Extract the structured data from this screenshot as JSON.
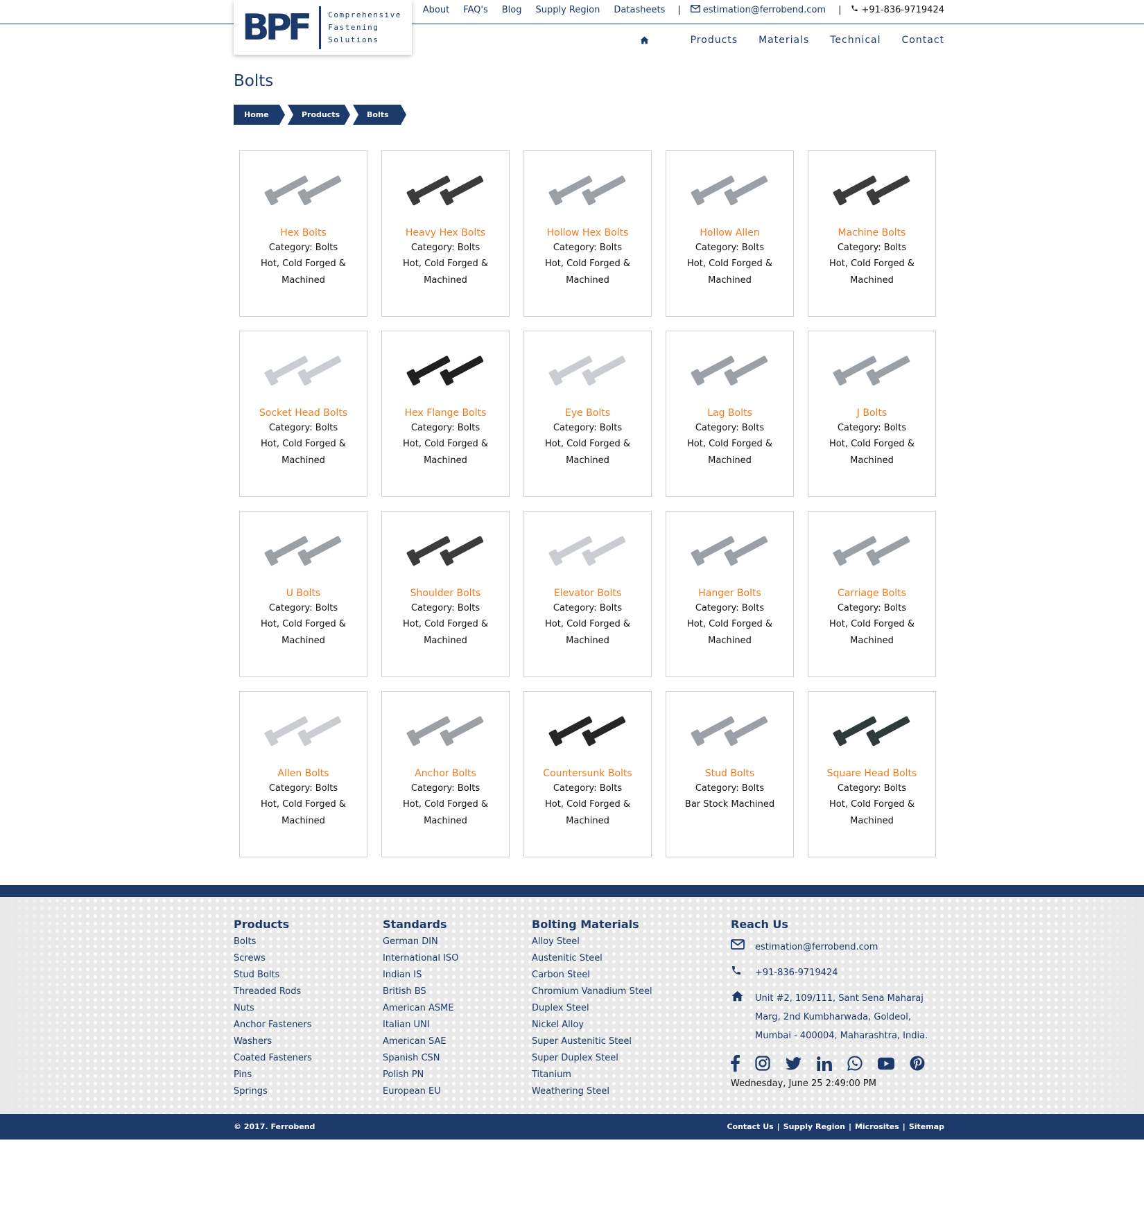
{
  "topbar": {
    "links": [
      "About",
      "FAQ's",
      "Blog",
      "Supply Region",
      "Datasheets"
    ],
    "separator": "|",
    "email": "estimation@ferrobend.com",
    "phone": "+91-836-9719424"
  },
  "logo": {
    "letters": "BPF",
    "tagline": [
      "Comprehensive",
      "Fastening",
      "Solutions"
    ]
  },
  "nav": {
    "home_icon": "home-icon",
    "items": [
      "Products",
      "Materials",
      "Technical",
      "Contact"
    ]
  },
  "page": {
    "title": "Bolts",
    "breadcrumb": [
      "Home",
      "Products",
      "Bolts"
    ]
  },
  "colors": {
    "brand_navy": "#1b3a6b",
    "product_orange": "#ef7d22"
  },
  "products": [
    {
      "name": "Hex Bolts",
      "category": "Category: Bolts",
      "desc": "Hot, Cold Forged & Machined",
      "icon": "hex-bolt-image"
    },
    {
      "name": "Heavy Hex Bolts",
      "category": "Category: Bolts",
      "desc": "Hot, Cold Forged & Machined",
      "icon": "heavy-hex-bolt-image"
    },
    {
      "name": "Hollow Hex Bolts",
      "category": "Category: Bolts",
      "desc": "Hot, Cold Forged & Machined",
      "icon": "hollow-hex-bolt-image"
    },
    {
      "name": "Hollow Allen",
      "category": "Category: Bolts",
      "desc": "Hot, Cold Forged & Machined",
      "icon": "hollow-allen-image"
    },
    {
      "name": "Machine Bolts",
      "category": "Category: Bolts",
      "desc": "Hot, Cold Forged & Machined",
      "icon": "machine-bolt-image"
    },
    {
      "name": "Socket Head Bolts",
      "category": "Category: Bolts",
      "desc": "Hot, Cold Forged & Machined",
      "icon": "socket-head-bolt-image"
    },
    {
      "name": "Hex Flange Bolts",
      "category": "Category: Bolts",
      "desc": "Hot, Cold Forged & Machined",
      "icon": "hex-flange-bolt-image"
    },
    {
      "name": "Eye Bolts",
      "category": "Category: Bolts",
      "desc": "Hot, Cold Forged & Machined",
      "icon": "eye-bolt-image"
    },
    {
      "name": "Lag Bolts",
      "category": "Category: Bolts",
      "desc": "Hot, Cold Forged & Machined",
      "icon": "lag-bolt-image"
    },
    {
      "name": "J Bolts",
      "category": "Category: Bolts",
      "desc": "Hot, Cold Forged & Machined",
      "icon": "j-bolt-image"
    },
    {
      "name": "U Bolts",
      "category": "Category: Bolts",
      "desc": "Hot, Cold Forged & Machined",
      "icon": "u-bolt-image"
    },
    {
      "name": "Shoulder Bolts",
      "category": "Category: Bolts",
      "desc": "Hot, Cold Forged & Machined",
      "icon": "shoulder-bolt-image"
    },
    {
      "name": "Elevator Bolts",
      "category": "Category: Bolts",
      "desc": "Hot, Cold Forged & Machined",
      "icon": "elevator-bolt-image"
    },
    {
      "name": "Hanger Bolts",
      "category": "Category: Bolts",
      "desc": "Hot, Cold Forged & Machined",
      "icon": "hanger-bolt-image"
    },
    {
      "name": "Carriage Bolts",
      "category": "Category: Bolts",
      "desc": "Hot, Cold Forged & Machined",
      "icon": "carriage-bolt-image"
    },
    {
      "name": "Allen Bolts",
      "category": "Category: Bolts",
      "desc": "Hot, Cold Forged & Machined",
      "icon": "allen-bolt-image"
    },
    {
      "name": "Anchor Bolts",
      "category": "Category: Bolts",
      "desc": "Hot, Cold Forged & Machined",
      "icon": "anchor-bolt-image"
    },
    {
      "name": "Countersunk Bolts",
      "category": "Category: Bolts",
      "desc": "Hot, Cold Forged & Machined",
      "icon": "countersunk-bolt-image"
    },
    {
      "name": "Stud Bolts",
      "category": "Category: Bolts",
      "desc": "Bar Stock Machined",
      "icon": "stud-bolt-image"
    },
    {
      "name": "Square Head Bolts",
      "category": "Category: Bolts",
      "desc": "Hot, Cold Forged & Machined",
      "icon": "square-head-bolt-image"
    }
  ],
  "footer": {
    "products": {
      "heading": "Products",
      "links": [
        "Bolts",
        "Screws",
        "Stud Bolts",
        "Threaded Rods",
        "Nuts",
        "Anchor Fasteners",
        "Washers",
        "Coated Fasteners",
        "Pins",
        "Springs"
      ]
    },
    "standards": {
      "heading": "Standards",
      "links": [
        "German DIN",
        "International ISO",
        "Indian IS",
        "British BS",
        "American ASME",
        "Italian UNI",
        "American SAE",
        "Spanish CSN",
        "Polish PN",
        "European EU"
      ]
    },
    "materials": {
      "heading": "Bolting Materials",
      "links": [
        "Alloy Steel",
        "Austenitic Steel",
        "Carbon Steel",
        "Chromium Vanadium Steel",
        "Duplex Steel",
        "Nickel Alloy",
        "Super Austenitic Steel",
        "Super Duplex Steel",
        "Titanium",
        "Weathering Steel"
      ]
    },
    "reach": {
      "heading": "Reach Us",
      "email": "estimation@ferrobend.com",
      "phone": "+91-836-9719424",
      "address": "Unit #2, 109/111, Sant Sena Maharaj Marg, 2nd Kumbharwada, Goldeol, Mumbai - 400004, Maharashtra, India."
    },
    "socials": [
      "facebook-icon",
      "instagram-icon",
      "twitter-icon",
      "linkedin-icon",
      "whatsapp-icon",
      "youtube-icon",
      "pinterest-icon"
    ],
    "datetime": "Wednesday, June 25 2:49:00 PM"
  },
  "bottom": {
    "copyright": "© 2017. Ferrobend",
    "links": [
      "Contact Us",
      "Supply Region",
      "Microsites",
      "Sitemap"
    ],
    "separator": "|"
  }
}
